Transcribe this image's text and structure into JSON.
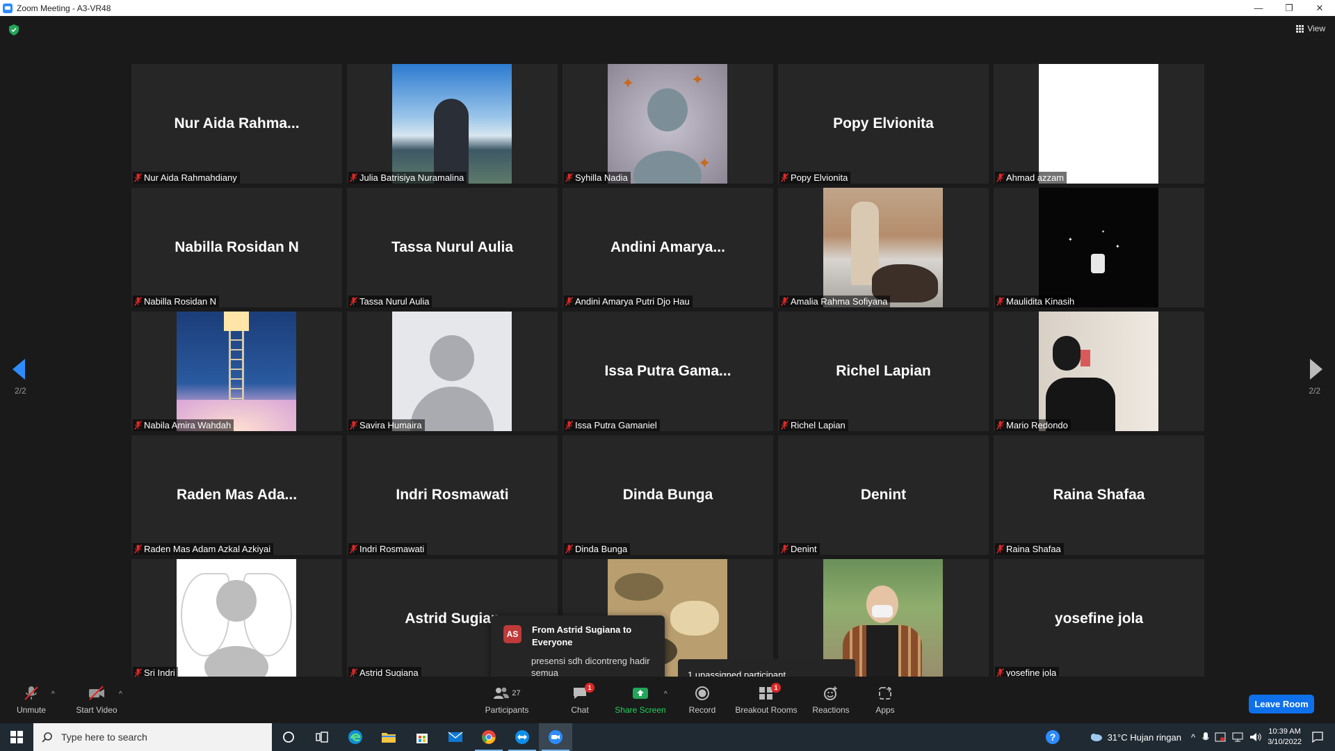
{
  "window": {
    "title": "Zoom Meeting - A3-VR48",
    "minimize": "—",
    "restore": "❐",
    "close": "✕"
  },
  "view_label": "View",
  "pagination": {
    "left": "2/2",
    "right": "2/2"
  },
  "tiles": [
    {
      "big": "Nur Aida Rahma...",
      "label": "Nur Aida Rahmahdiany",
      "photo": ""
    },
    {
      "big": "",
      "label": "Julia Batrisiya Nuramalina",
      "photo": "sky"
    },
    {
      "big": "",
      "label": "Syhilla Nadia",
      "photo": "butterfly"
    },
    {
      "big": "Popy Elvionita",
      "label": "Popy Elvionita",
      "photo": ""
    },
    {
      "big": "",
      "label": "Ahmad azzam",
      "photo": "white"
    },
    {
      "big": "Nabilla Rosidan N",
      "label": "Nabilla Rosidan N",
      "photo": ""
    },
    {
      "big": "Tassa Nurul Aulia",
      "label": "Tassa Nurul Aulia",
      "photo": ""
    },
    {
      "big": "Andini  Amarya...",
      "label": "Andini Amarya Putri Djo Hau",
      "photo": ""
    },
    {
      "big": "",
      "label": "Amalia Rahma Sofiyana",
      "photo": "dog"
    },
    {
      "big": "",
      "label": "Maulidita Kinasih",
      "photo": "dark"
    },
    {
      "big": "",
      "label": "Nabila Amira Wahdah",
      "photo": "ladder"
    },
    {
      "big": "",
      "label": "Savira Humaira",
      "photo": "default"
    },
    {
      "big": "Issa Putra Gama...",
      "label": "Issa Putra Gamaniel",
      "photo": ""
    },
    {
      "big": "Richel Lapian",
      "label": "Richel Lapian",
      "photo": ""
    },
    {
      "big": "",
      "label": "Mario Redondo",
      "photo": "mirror"
    },
    {
      "big": "Raden Mas Ada...",
      "label": "Raden Mas Adam Azkal Azkiyai",
      "photo": ""
    },
    {
      "big": "Indri Rosmawati",
      "label": "Indri Rosmawati",
      "photo": ""
    },
    {
      "big": "Dinda Bunga",
      "label": "Dinda Bunga",
      "photo": ""
    },
    {
      "big": "Denint",
      "label": "Denint",
      "photo": ""
    },
    {
      "big": "Raina Shafaa",
      "label": "Raina Shafaa",
      "photo": ""
    },
    {
      "big": "",
      "label": "Sri Indri",
      "photo": "angel"
    },
    {
      "big": "Astrid Sugian",
      "label": "Astrid Sugiana",
      "photo": ""
    },
    {
      "big": "",
      "label": "",
      "photo": "camo"
    },
    {
      "big": "",
      "label": "",
      "photo": "man"
    },
    {
      "big": "yosefine jola",
      "label": "yosefine jola",
      "photo": ""
    }
  ],
  "chat_toast": {
    "initials": "AS",
    "from": "From Astrid Sugiana to Everyone",
    "message": "presensi sdh dicontreng hadir semua"
  },
  "unassigned": "1 unassigned participant",
  "toolbar": {
    "unmute": "Unmute",
    "start_video": "Start Video",
    "participants": "Participants",
    "participants_count": "27",
    "chat": "Chat",
    "chat_badge": "1",
    "share_screen": "Share Screen",
    "record": "Record",
    "breakout_rooms": "Breakout Rooms",
    "breakout_badge": "1",
    "reactions": "Reactions",
    "apps": "Apps",
    "leave": "Leave Room"
  },
  "taskbar": {
    "search_placeholder": "Type here to search",
    "weather": "31°C  Hujan ringan",
    "time": "10:39 AM",
    "date": "3/10/2022"
  }
}
